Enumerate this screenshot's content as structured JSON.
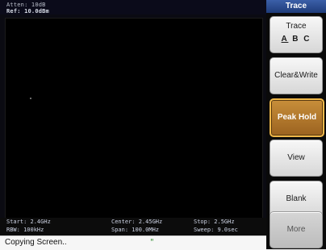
{
  "header": {
    "atten": "Atten: 10dB",
    "ref": "Ref: 10.0dBm"
  },
  "footer": {
    "start": "Start: 2.4GHz",
    "center": "Center: 2.45GHz",
    "stop": "Stop: 2.5GHz",
    "rbw": "RBW: 100kHz",
    "span": "Span: 100.0MHz",
    "sweep": "Sweep: 9.0sec"
  },
  "status": {
    "text": "Copying Screen..",
    "mark": "\""
  },
  "panel": {
    "title": "Trace",
    "trace": {
      "label": "Trace",
      "options": [
        "A",
        "B",
        "C"
      ],
      "selected": "A"
    },
    "buttons": [
      {
        "label": "Clear&Write",
        "state": "normal"
      },
      {
        "label": "Peak Hold",
        "state": "active"
      },
      {
        "label": "View",
        "state": "normal"
      },
      {
        "label": "Blank",
        "state": "normal"
      },
      {
        "label": "More",
        "state": "disabled"
      }
    ]
  },
  "colors": {
    "accent_active": "#c88f3a",
    "panel_title": "#2d4f95",
    "display_bg": "#000000"
  }
}
